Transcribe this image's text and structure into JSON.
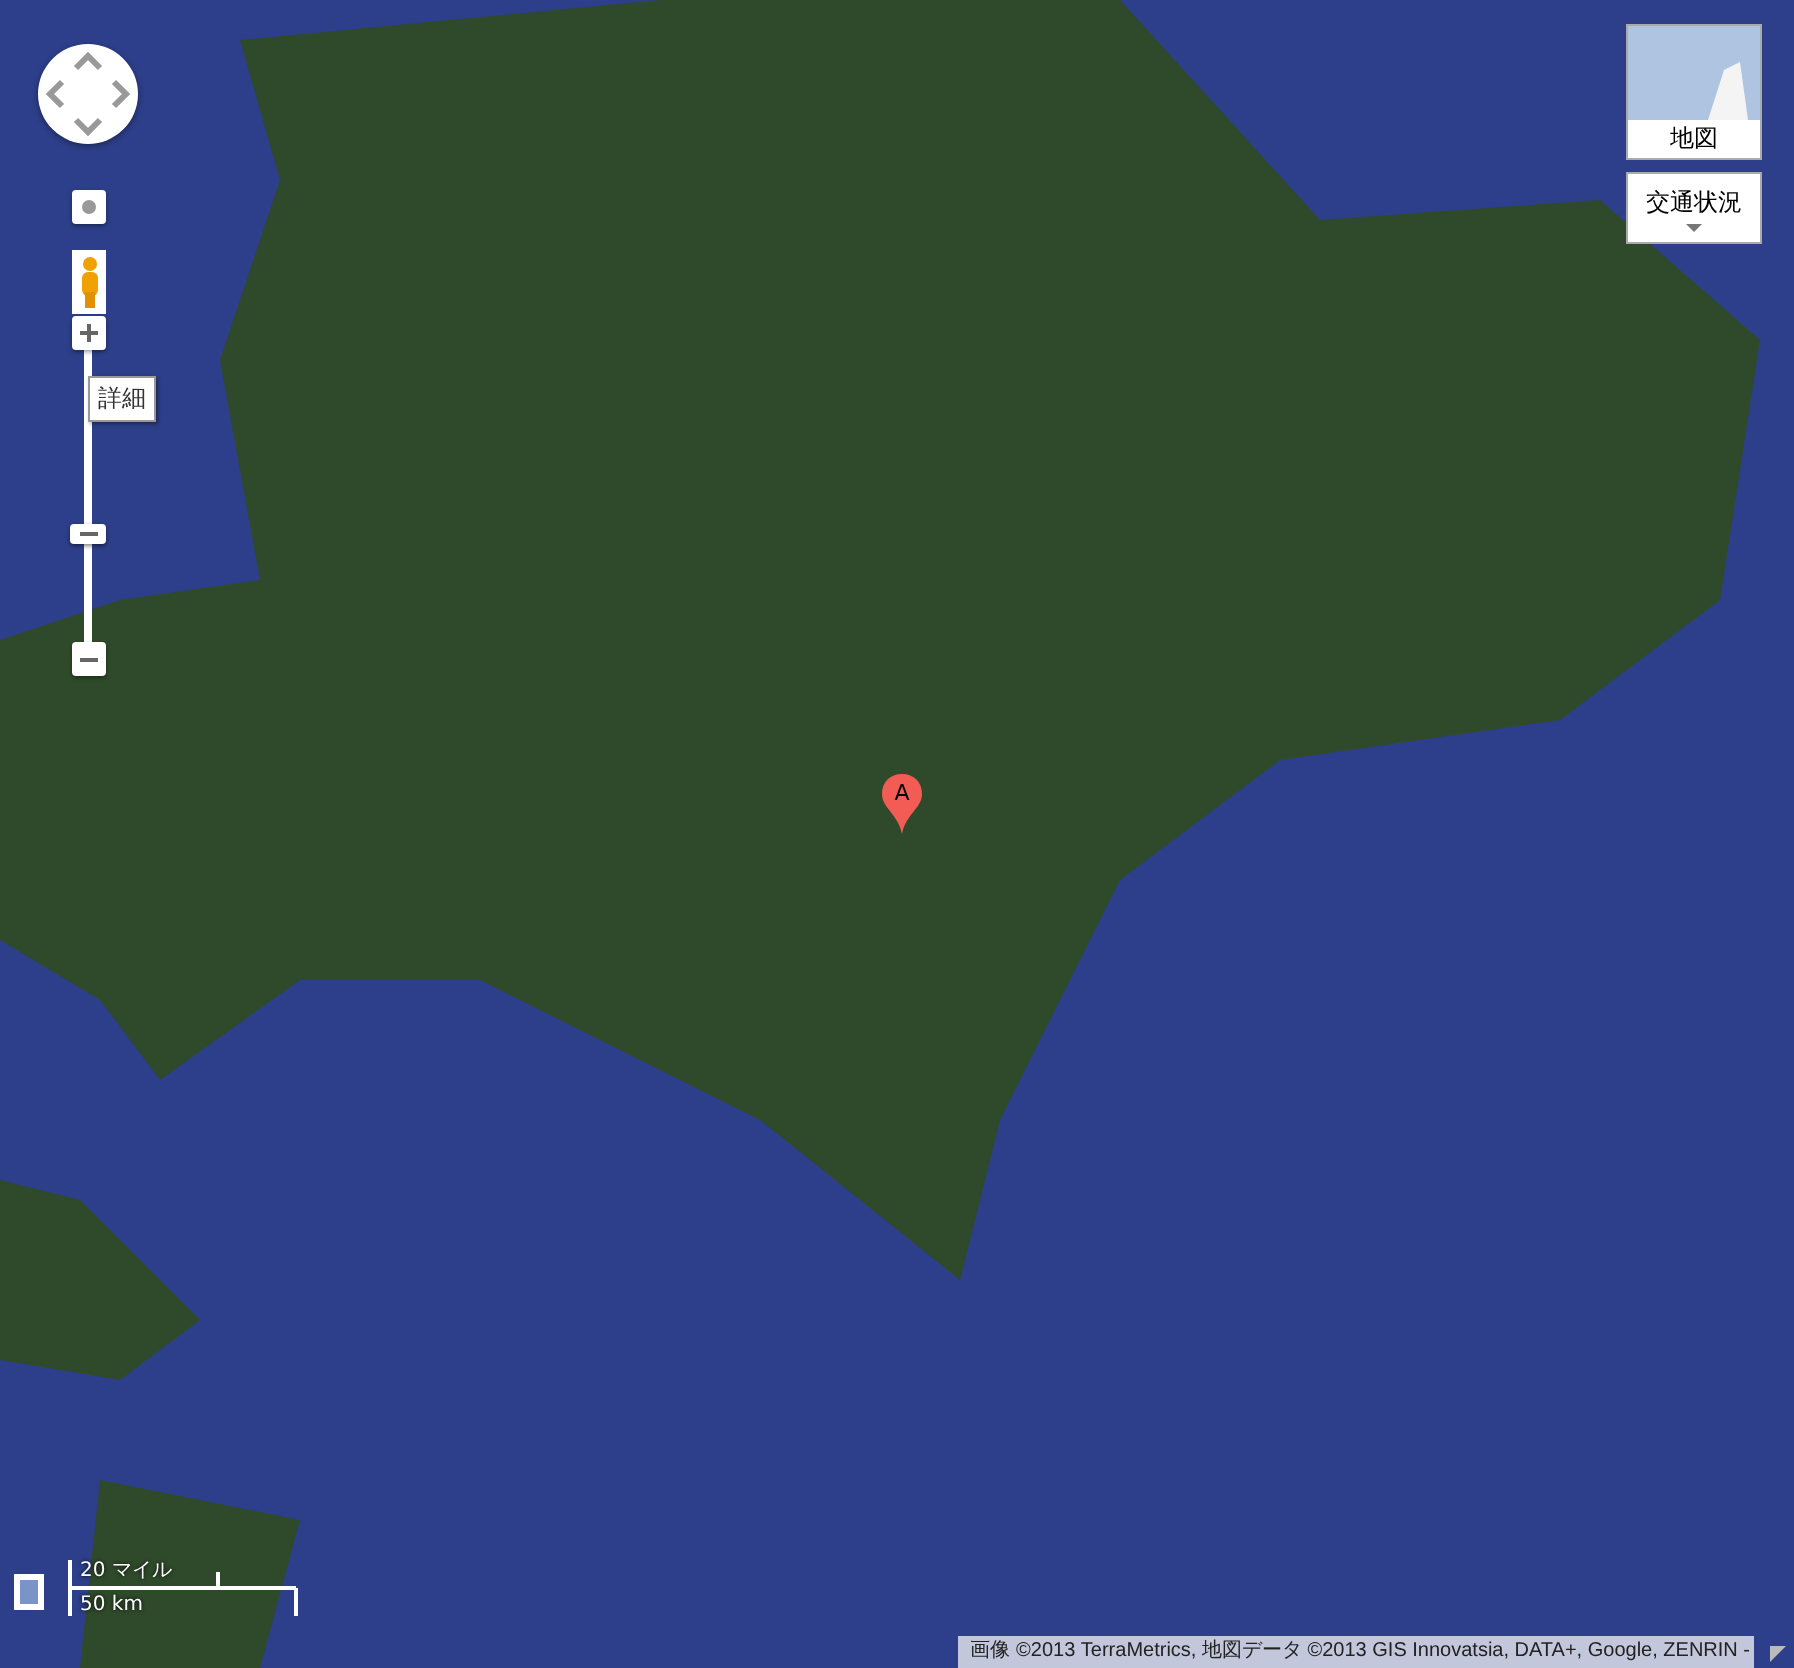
{
  "zoom_control": {
    "tooltip": "詳細",
    "level": 0.38
  },
  "map_type": {
    "label": "地図"
  },
  "traffic": {
    "label": "交通状況"
  },
  "marker": {
    "label": "A"
  },
  "scale": {
    "miles": "20 マイル",
    "km": "50 km"
  },
  "attribution": "画像 ©2013 TerraMetrics, 地図データ ©2013 GIS Innovatsia, DATA+, Google, ZENRIN -"
}
